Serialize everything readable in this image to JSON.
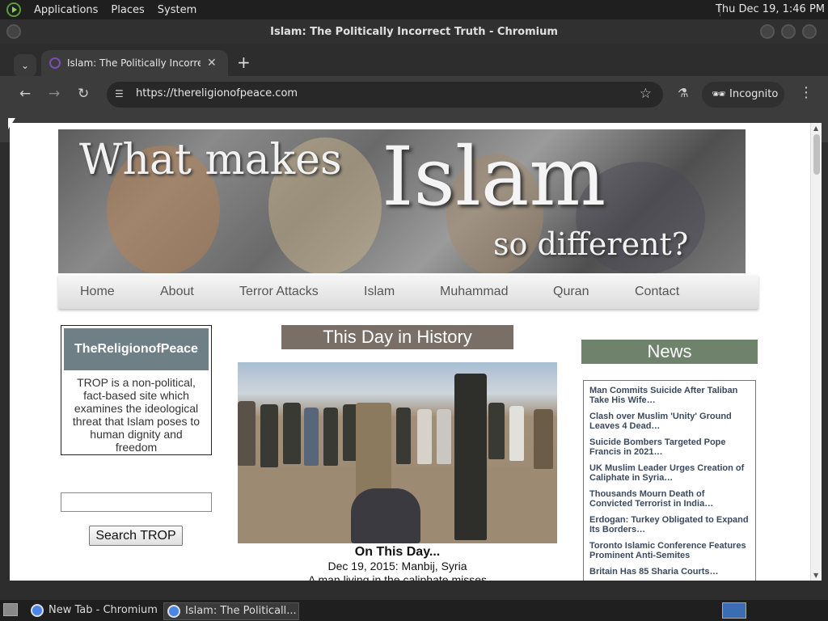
{
  "top_panel": {
    "menus": [
      "Applications",
      "Places",
      "System"
    ],
    "clock": "Thu Dec 19,  1:46 PM"
  },
  "window": {
    "title": "Islam: The Politically Incorrect Truth - Chromium",
    "tab_title": "Islam: The Politically Incorrect Truth",
    "url": "https://thereligionofpeace.com",
    "incognito_label": "Incognito"
  },
  "page": {
    "banner": {
      "line1": "What makes",
      "line2": "Islam",
      "line3": "so different?"
    },
    "nav": [
      "Home",
      "About",
      "Terror Attacks",
      "Islam",
      "Muhammad",
      "Quran",
      "Contact"
    ],
    "sidebar": {
      "heading": "TheReligionofPeace",
      "description": "TROP is a non-political, fact-based site which examines the ideological threat that Islam poses to human dignity and freedom",
      "search_button": "Search TROP"
    },
    "history": {
      "title": "This Day in History",
      "caption_title": "On This Day...",
      "caption_date": "Dec 19, 2015: Manbij, Syria",
      "caption_text": "A man living in the caliphate misses"
    },
    "news": {
      "title": "News",
      "items": [
        "Man Commits Suicide After Taliban Take His Wife…",
        "Clash over Muslim 'Unity' Ground Leaves 4 Dead…",
        "Suicide Bombers Targeted Pope Francis in 2021…",
        "UK Muslim Leader Urges Creation of Caliphate in Syria…",
        "Thousands Mourn Death of Convicted Terrorist in India…",
        "Erdogan: Turkey Obligated to Expand Its Borders…",
        "Toronto Islamic Conference Features Prominent Anti-Semites",
        "Britain Has 85 Sharia Courts…"
      ]
    }
  },
  "taskbar": {
    "tasks": [
      "New Tab - Chromium",
      "Islam: The Politicall..."
    ]
  }
}
